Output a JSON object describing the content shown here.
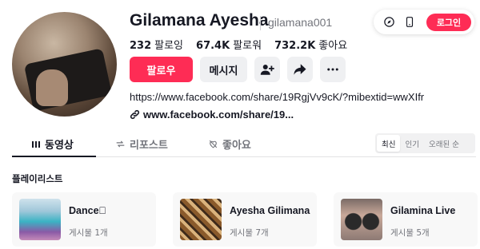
{
  "profile": {
    "name": "Gilamana Ayesha",
    "handle": "gilamana001",
    "stats": [
      {
        "value": "232",
        "label": "팔로잉"
      },
      {
        "value": "67.4K",
        "label": "팔로워"
      },
      {
        "value": "732.2K",
        "label": "좋아요"
      }
    ],
    "follow_label": "팔로우",
    "message_label": "메시지",
    "bio": "https://www.facebook.com/share/19RgjVv9cK/?mibextid=wwXIfr",
    "link": "www.facebook.com/share/19..."
  },
  "topbar": {
    "login_label": "로그인"
  },
  "tabs": [
    {
      "label": "동영상",
      "icon": "grid-icon"
    },
    {
      "label": "리포스트",
      "icon": "repost-icon"
    },
    {
      "label": "좋아요",
      "icon": "liked-icon"
    }
  ],
  "sort": [
    "최신",
    "인기",
    "오래된 순"
  ],
  "playlist": {
    "title": "플레이리스트",
    "items": [
      {
        "title": "Dance\u0000",
        "count": "게시물 1개"
      },
      {
        "title": "Ayesha Gilimana",
        "count": "게시물 7개"
      },
      {
        "title": "Gilamina Live",
        "count": "게시물 5개"
      }
    ]
  },
  "colors": {
    "accent": "#fe2c55",
    "text": "#161823",
    "muted": "#73757c",
    "button_bg": "#eff0f2"
  }
}
